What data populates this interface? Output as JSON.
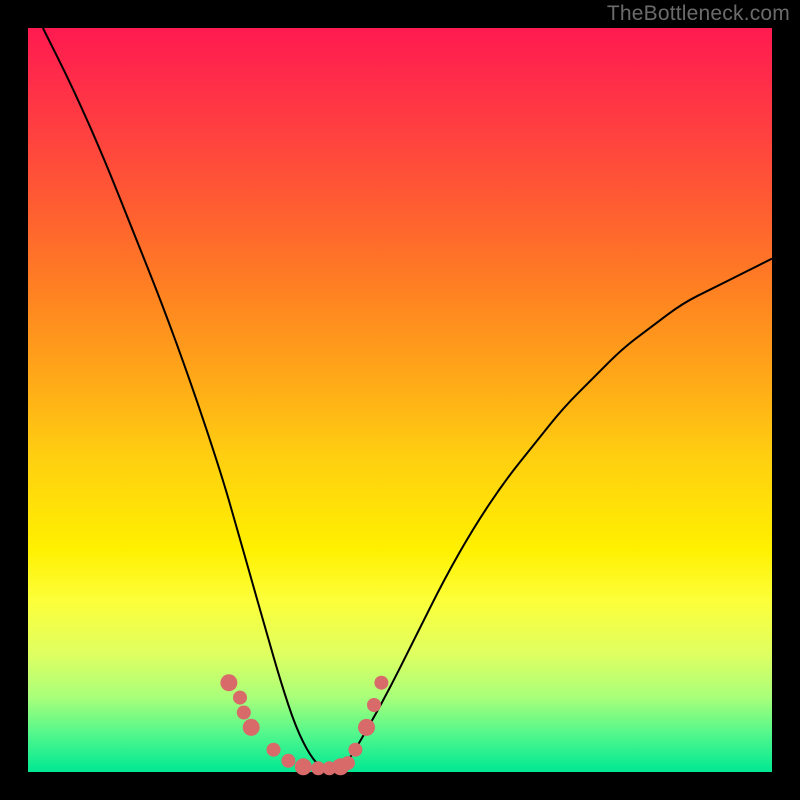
{
  "watermark": "TheBottleneck.com",
  "chart_data": {
    "type": "line",
    "title": "",
    "xlabel": "",
    "ylabel": "",
    "xlim": [
      0,
      100
    ],
    "ylim": [
      0,
      100
    ],
    "series": [
      {
        "name": "bottleneck-curve",
        "color": "#000000",
        "x": [
          2,
          6,
          10,
          14,
          18,
          22,
          26,
          28,
          30,
          32,
          34,
          36,
          38,
          40,
          42,
          44,
          48,
          52,
          56,
          60,
          64,
          68,
          72,
          76,
          80,
          84,
          88,
          92,
          96,
          100
        ],
        "y": [
          100,
          92,
          83,
          73,
          63,
          52,
          40,
          33,
          26,
          19,
          12,
          6,
          2,
          0,
          0,
          3,
          10,
          18,
          26,
          33,
          39,
          44,
          49,
          53,
          57,
          60,
          63,
          65,
          67,
          69
        ]
      },
      {
        "name": "highlight-dots",
        "color": "#d86a6a",
        "x": [
          27,
          28.5,
          29,
          30,
          33,
          35,
          37,
          39,
          40.5,
          42,
          43,
          44,
          45.5,
          46.5,
          47.5
        ],
        "y": [
          12,
          10,
          8,
          6,
          3,
          1.5,
          0.7,
          0.5,
          0.5,
          0.7,
          1.2,
          3,
          6,
          9,
          12
        ]
      }
    ],
    "annotations": [],
    "legend": false,
    "grid": false
  },
  "colors": {
    "background_top": "#ff1a50",
    "background_bottom": "#00e892",
    "curve": "#000000",
    "dots": "#d86a6a",
    "frame": "#000000",
    "watermark": "#6b6b6b"
  }
}
